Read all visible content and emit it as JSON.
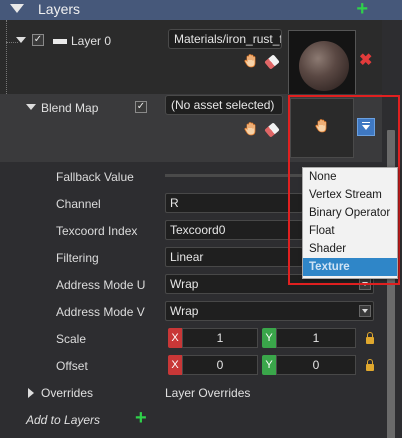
{
  "header": {
    "title": "Layers",
    "add_icon": "plus-icon"
  },
  "layer0": {
    "label": "Layer 0",
    "checked": true,
    "material_value": "Materials/iron_rust_f",
    "icons": [
      "hand-icon",
      "eraser-icon",
      "remove-x-icon"
    ]
  },
  "blend_map": {
    "label": "Blend Map",
    "checked": true,
    "asset_value": "(No asset selected)"
  },
  "properties": {
    "fallback_value": {
      "label": "Fallback Value",
      "value": ""
    },
    "channel": {
      "label": "Channel",
      "value": "R"
    },
    "texcoord_index": {
      "label": "Texcoord Index",
      "value": "Texcoord0"
    },
    "filtering": {
      "label": "Filtering",
      "value": "Linear"
    },
    "address_mode_u": {
      "label": "Address Mode U",
      "value": "Wrap"
    },
    "address_mode_v": {
      "label": "Address Mode V",
      "value": "Wrap"
    },
    "scale": {
      "label": "Scale",
      "x_label": "X",
      "x": "1",
      "y_label": "Y",
      "y": "1"
    },
    "offset": {
      "label": "Offset",
      "x_label": "X",
      "x": "0",
      "y_label": "Y",
      "y": "0"
    },
    "overrides": {
      "label": "Overrides",
      "value": "Layer Overrides"
    }
  },
  "footer": {
    "add_to_layers": "Add to Layers"
  },
  "dropdown_menu": {
    "items": [
      "None",
      "Vertex Stream",
      "Binary Operator",
      "Float",
      "Shader",
      "Texture"
    ],
    "selected": "Texture"
  },
  "colors": {
    "header_bg": "#46587a",
    "accent_green": "#2fd14a",
    "highlight_red": "#e02020",
    "x_axis": "#c83737",
    "y_axis": "#3aa64a",
    "selection_blue": "#2f86c8"
  }
}
